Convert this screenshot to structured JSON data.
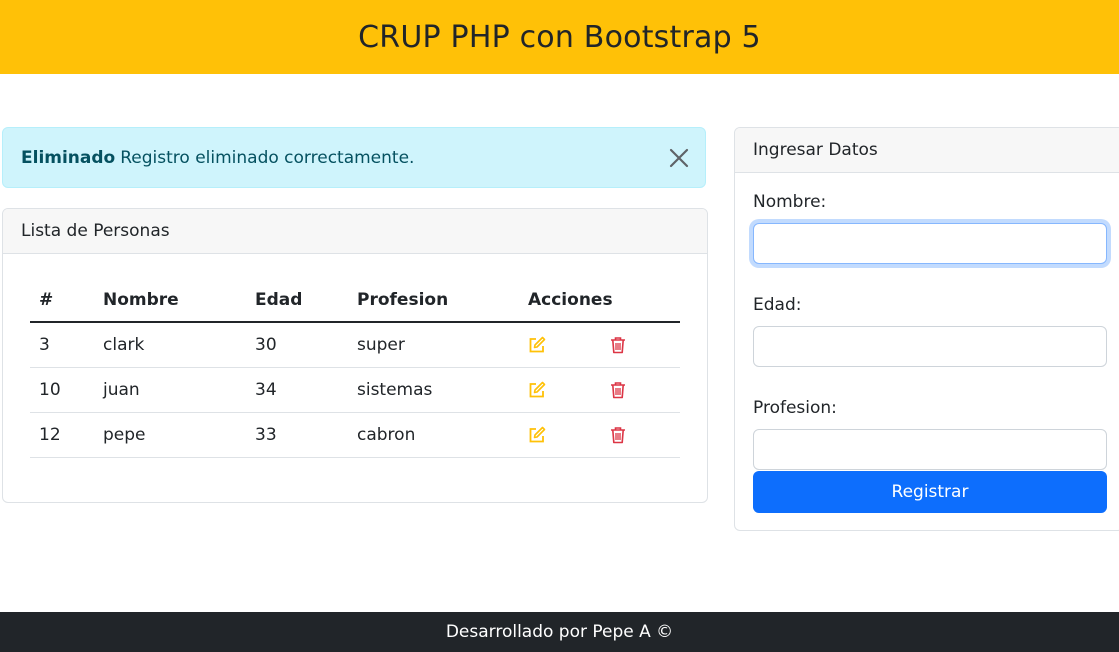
{
  "header": {
    "title": "CRUP PHP con Bootstrap 5"
  },
  "alert": {
    "strong": "Eliminado",
    "message": "Registro eliminado correctamente.",
    "close_icon": "close-icon",
    "color": "#cff4fc"
  },
  "list": {
    "title": "Lista de Personas",
    "columns": [
      "#",
      "Nombre",
      "Edad",
      "Profesion",
      "Acciones"
    ],
    "rows": [
      {
        "id": "3",
        "nombre": "clark",
        "edad": "30",
        "profesion": "super"
      },
      {
        "id": "10",
        "nombre": "juan",
        "edad": "34",
        "profesion": "sistemas"
      },
      {
        "id": "12",
        "nombre": "pepe",
        "edad": "33",
        "profesion": "cabron"
      }
    ],
    "edit_icon": "edit-icon",
    "delete_icon": "trash-icon",
    "edit_color": "#ffc107",
    "delete_color": "#dc3545"
  },
  "form": {
    "title": "Ingresar Datos",
    "nombre_label": "Nombre:",
    "nombre_value": "",
    "edad_label": "Edad:",
    "edad_value": "",
    "profesion_label": "Profesion:",
    "profesion_value": "",
    "submit_label": "Registrar",
    "submit_color": "#0d6efd"
  },
  "footer": {
    "text": "Desarrollado por Pepe A ©"
  },
  "colors": {
    "header": "#ffc107",
    "footer": "#212529"
  }
}
